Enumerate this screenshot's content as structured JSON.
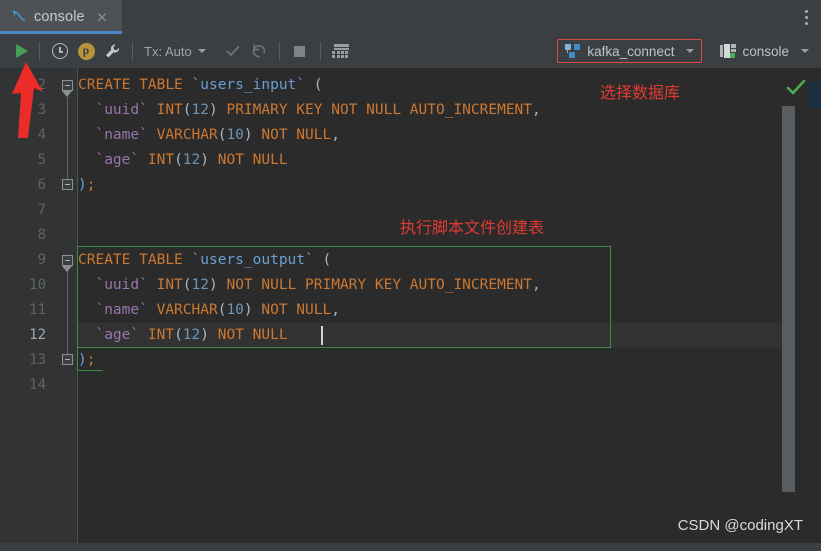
{
  "window": {
    "title": "console"
  },
  "tabbar": {
    "tab_label": "console",
    "tab_icon": "mysql-dolphin-icon",
    "close_label": "×",
    "kebab_icon": "more-options-icon"
  },
  "toolbar": {
    "run_label": "Execute",
    "history_label": "History",
    "profile_badge": "p",
    "wrench_label": "Settings",
    "tx_label": "Tx:",
    "tx_value": "Auto",
    "commit_label": "Commit",
    "rollback_label": "Rollback",
    "stop_label": "Stop",
    "grid_label": "Data Grid",
    "database": "kafka_connect",
    "session": "console"
  },
  "annotations": {
    "select_database": "选择数据库",
    "run_script": "执行脚本文件创建表",
    "arrow": "red-arrow-up",
    "check": "✔"
  },
  "editor": {
    "first_visible_line": 2,
    "current_line": 12,
    "lines": [
      {
        "n": 2,
        "indent": 0,
        "tokens": [
          {
            "t": "CREATE",
            "c": "kw"
          },
          {
            "t": " ",
            "c": "pun"
          },
          {
            "t": "TABLE",
            "c": "kw"
          },
          {
            "t": " ",
            "c": "pun"
          },
          {
            "t": "`users_input`",
            "c": "tbl"
          },
          {
            "t": " ",
            "c": "pun"
          },
          {
            "t": "(",
            "c": "pun"
          }
        ]
      },
      {
        "n": 3,
        "indent": 1,
        "tokens": [
          {
            "t": "`uuid`",
            "c": "id"
          },
          {
            "t": " ",
            "c": "pun"
          },
          {
            "t": "INT",
            "c": "kw"
          },
          {
            "t": "(",
            "c": "pun"
          },
          {
            "t": "12",
            "c": "num"
          },
          {
            "t": ")",
            "c": "pun"
          },
          {
            "t": " ",
            "c": "pun"
          },
          {
            "t": "PRIMARY KEY NOT NULL AUTO_INCREMENT",
            "c": "kw"
          },
          {
            "t": ",",
            "c": "pun"
          }
        ]
      },
      {
        "n": 4,
        "indent": 1,
        "tokens": [
          {
            "t": "`name`",
            "c": "id"
          },
          {
            "t": " ",
            "c": "pun"
          },
          {
            "t": "VARCHAR",
            "c": "kw"
          },
          {
            "t": "(",
            "c": "pun"
          },
          {
            "t": "10",
            "c": "num"
          },
          {
            "t": ")",
            "c": "pun"
          },
          {
            "t": " ",
            "c": "pun"
          },
          {
            "t": "NOT NULL",
            "c": "kw"
          },
          {
            "t": ",",
            "c": "pun"
          }
        ]
      },
      {
        "n": 5,
        "indent": 1,
        "tokens": [
          {
            "t": "`age`",
            "c": "id"
          },
          {
            "t": " ",
            "c": "pun"
          },
          {
            "t": "INT",
            "c": "kw"
          },
          {
            "t": "(",
            "c": "pun"
          },
          {
            "t": "12",
            "c": "num"
          },
          {
            "t": ")",
            "c": "pun"
          },
          {
            "t": " ",
            "c": "pun"
          },
          {
            "t": "NOT NULL",
            "c": "kw"
          }
        ]
      },
      {
        "n": 6,
        "indent": 0,
        "tokens": [
          {
            "t": ")",
            "c": "tbl"
          },
          {
            "t": ";",
            "c": "semi"
          }
        ]
      },
      {
        "n": 7,
        "indent": 0,
        "tokens": []
      },
      {
        "n": 8,
        "indent": 0,
        "tokens": []
      },
      {
        "n": 9,
        "indent": 0,
        "tokens": [
          {
            "t": "CREATE",
            "c": "kw"
          },
          {
            "t": " ",
            "c": "pun"
          },
          {
            "t": "TABLE",
            "c": "kw"
          },
          {
            "t": " ",
            "c": "pun"
          },
          {
            "t": "`users_output`",
            "c": "tbl"
          },
          {
            "t": " ",
            "c": "pun"
          },
          {
            "t": "(",
            "c": "pun"
          }
        ]
      },
      {
        "n": 10,
        "indent": 1,
        "tokens": [
          {
            "t": "`uuid`",
            "c": "id"
          },
          {
            "t": " ",
            "c": "pun"
          },
          {
            "t": "INT",
            "c": "kw"
          },
          {
            "t": "(",
            "c": "pun"
          },
          {
            "t": "12",
            "c": "num"
          },
          {
            "t": ")",
            "c": "pun"
          },
          {
            "t": " ",
            "c": "pun"
          },
          {
            "t": "NOT NULL PRIMARY KEY AUTO_INCREMENT",
            "c": "kw"
          },
          {
            "t": ",",
            "c": "pun"
          }
        ]
      },
      {
        "n": 11,
        "indent": 1,
        "tokens": [
          {
            "t": "`name`",
            "c": "id"
          },
          {
            "t": " ",
            "c": "pun"
          },
          {
            "t": "VARCHAR",
            "c": "kw"
          },
          {
            "t": "(",
            "c": "pun"
          },
          {
            "t": "10",
            "c": "num"
          },
          {
            "t": ")",
            "c": "pun"
          },
          {
            "t": " ",
            "c": "pun"
          },
          {
            "t": "NOT NULL",
            "c": "kw"
          },
          {
            "t": ",",
            "c": "pun"
          }
        ]
      },
      {
        "n": 12,
        "indent": 1,
        "tokens": [
          {
            "t": "`age`",
            "c": "id"
          },
          {
            "t": " ",
            "c": "pun"
          },
          {
            "t": "INT",
            "c": "kw"
          },
          {
            "t": "(",
            "c": "pun"
          },
          {
            "t": "12",
            "c": "num"
          },
          {
            "t": ")",
            "c": "pun"
          },
          {
            "t": " ",
            "c": "pun"
          },
          {
            "t": "NOT NULL",
            "c": "kw"
          }
        ]
      },
      {
        "n": 13,
        "indent": 0,
        "tokens": [
          {
            "t": ")",
            "c": "tbl"
          },
          {
            "t": ";",
            "c": "semi"
          }
        ]
      },
      {
        "n": 14,
        "indent": 0,
        "tokens": []
      }
    ]
  },
  "watermark": "CSDN @codingXT",
  "colors": {
    "bg_editor": "#2b2b2b",
    "bg_chrome": "#3c3f41",
    "gutter": "#313335",
    "accent_blue": "#4a88c7",
    "annotation_red": "#e03a32",
    "selection_green": "#3d8c40",
    "run_green": "#499c54",
    "keyword_orange": "#cc7832",
    "identifier_purple": "#9876aa",
    "table_blue": "#6a9fd4",
    "number_blue": "#6897bb"
  }
}
